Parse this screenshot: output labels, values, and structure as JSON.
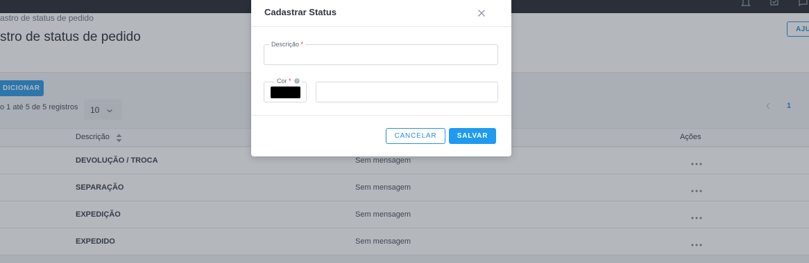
{
  "page": {
    "breadcrumb": "astro de status de pedido",
    "title": "stro de status de pedido",
    "help_button": "AJU",
    "add_button": "DICIONAR",
    "records_text": "o 1 até 5 de 5 registros",
    "page_size": "10",
    "current_page": "1"
  },
  "table": {
    "columns": {
      "description": "Descrição",
      "actions": "Ações"
    },
    "rows": [
      {
        "description": "DEVOLUÇÃO / TROCA",
        "message": "Sem mensagem"
      },
      {
        "description": "SEPARAÇÃO",
        "message": "Sem mensagem"
      },
      {
        "description": "EXPEDIÇÃO",
        "message": "Sem mensagem"
      },
      {
        "description": "EXPEDIDO",
        "message": "Sem mensagem"
      }
    ]
  },
  "modal": {
    "title": "Cadastrar Status",
    "description_label": "Descrição",
    "description_value": "",
    "color_label": "Cor",
    "required_mark": "*",
    "color_value": "",
    "selected_color": "#000000",
    "cancel_label": "CANCELAR",
    "save_label": "SALVAR"
  },
  "icons": {
    "topbar": [
      "bell-icon",
      "checkbox-icon",
      "chat-icon"
    ],
    "close": "close-icon",
    "sort": "sort-icon",
    "help": "question-icon",
    "actions": "more-horizontal-icon"
  },
  "colors": {
    "accent": "#1e9bf0",
    "topbar": "#2b2e36",
    "required": "#e0303f"
  }
}
